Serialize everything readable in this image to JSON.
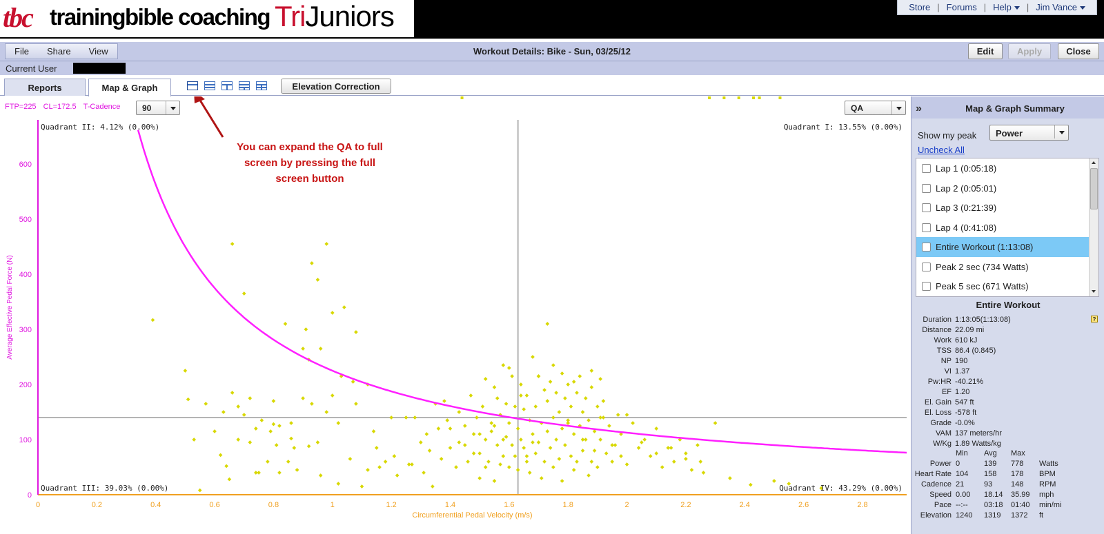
{
  "banner": {
    "logo_tbc": "tbc",
    "logo_main": "trainingbible coaching",
    "logo_tri": "Tri",
    "logo_juniors": "Juniors",
    "nav": [
      {
        "label": "Store",
        "dropdown": false
      },
      {
        "label": "Forums",
        "dropdown": false
      },
      {
        "label": "Help",
        "dropdown": true
      },
      {
        "label": "Jim Vance",
        "dropdown": true
      }
    ]
  },
  "toolbar": {
    "menu": [
      "File",
      "Share",
      "View"
    ],
    "title": "Workout Details: Bike - Sun, 03/25/12",
    "edit_label": "Edit",
    "apply_label": "Apply",
    "close_label": "Close"
  },
  "user": {
    "label": "Current User"
  },
  "tabs": {
    "reports": "Reports",
    "map_graph": "Map & Graph",
    "elevation": "Elevation Correction"
  },
  "chart_panel": {
    "ftp": "FTP=225",
    "cl": "CL=172.5",
    "tcadence": "T-Cadence",
    "cadence_value": "90",
    "mode_value": "QA",
    "annotation": [
      "You can expand the QA to full",
      "screen by pressing the full",
      "screen button"
    ]
  },
  "chart_data": {
    "type": "scatter",
    "xlabel": "Circumferential Pedal Velocity (m/s)",
    "ylabel": "Average Effective Pedal Force (N)",
    "xlim": [
      0,
      2.95
    ],
    "ylim": [
      0,
      680
    ],
    "xticks": [
      0,
      0.2,
      0.4,
      0.6,
      0.8,
      1,
      1.2,
      1.4,
      1.6,
      1.8,
      2,
      2.2,
      2.4,
      2.6,
      2.8
    ],
    "xtick_labels": [
      "0",
      "0.2",
      "0.4",
      "0.6",
      "0.8",
      "1",
      "1.2",
      "1.4",
      "1.6",
      "1.8",
      "2",
      "2.2",
      "2.4",
      "2.6",
      "2.8"
    ],
    "yticks": [
      0,
      100,
      200,
      300,
      400,
      500,
      600
    ],
    "ytick_labels": [
      "0",
      "100",
      "200",
      "300",
      "400",
      "500",
      "600"
    ],
    "quadrant_x": 1.63,
    "quadrant_y": 140,
    "quadrants": {
      "q1": "Quadrant I: 13.55% (0.00%)",
      "q2": "Quadrant II: 4.12% (0.00%)",
      "q3": "Quadrant III: 39.03% (0.00%)",
      "q4": "Quadrant IV: 43.29% (0.00%)"
    },
    "curve": {
      "ftp_watts": 225,
      "description": "force = FTP / velocity"
    },
    "colors": {
      "points": "#d8d800",
      "curve": "#ff20ff",
      "x_axis": "#f0a020",
      "y_axis": "#e018e0",
      "quadrant_lines": "#b4b4b4"
    },
    "points_x": [
      0.39,
      0.5,
      0.51,
      0.53,
      0.55,
      0.6,
      0.62,
      0.64,
      0.65,
      0.66,
      0.68,
      0.7,
      0.72,
      0.74,
      0.76,
      0.78,
      0.8,
      0.82,
      0.84,
      0.86,
      0.88,
      0.9,
      0.92,
      0.93,
      0.95,
      0.96,
      0.98,
      1.0,
      1.02,
      1.04,
      1.06,
      1.08,
      1.1,
      1.12,
      1.15,
      1.2,
      1.25,
      1.28,
      1.3,
      1.32,
      1.35,
      1.38,
      1.4,
      1.42,
      1.43,
      1.45,
      1.46,
      1.47,
      1.48,
      1.49,
      1.5,
      1.5,
      1.51,
      1.52,
      1.52,
      1.53,
      1.54,
      1.54,
      1.55,
      1.55,
      1.56,
      1.56,
      1.57,
      1.57,
      1.58,
      1.58,
      1.59,
      1.59,
      1.6,
      1.6,
      1.61,
      1.61,
      1.62,
      1.62,
      1.63,
      1.63,
      1.64,
      1.64,
      1.65,
      1.65,
      1.66,
      1.66,
      1.67,
      1.67,
      1.68,
      1.68,
      1.69,
      1.69,
      1.7,
      1.7,
      1.71,
      1.71,
      1.72,
      1.72,
      1.73,
      1.73,
      1.74,
      1.74,
      1.75,
      1.75,
      1.76,
      1.76,
      1.77,
      1.77,
      1.78,
      1.78,
      1.79,
      1.79,
      1.8,
      1.8,
      1.81,
      1.81,
      1.82,
      1.82,
      1.83,
      1.83,
      1.84,
      1.84,
      1.85,
      1.85,
      1.86,
      1.86,
      1.87,
      1.87,
      1.88,
      1.88,
      1.89,
      1.89,
      1.9,
      1.9,
      1.91,
      1.91,
      1.92,
      1.93,
      1.94,
      1.95,
      1.96,
      1.97,
      1.98,
      2.0,
      2.02,
      2.04,
      2.06,
      2.08,
      2.1,
      2.12,
      2.14,
      2.16,
      2.18,
      2.2,
      2.22,
      2.24,
      2.26,
      2.3,
      2.35,
      2.42,
      2.5,
      2.55,
      2.66,
      0.66,
      0.7,
      0.91,
      0.93,
      0.96,
      0.92,
      1.0,
      1.07,
      1.03,
      1.73,
      1.91,
      1.64,
      1.45,
      1.43,
      1.4,
      1.66,
      0.82,
      0.9,
      1.08,
      1.55,
      1.6,
      1.75,
      1.8,
      1.85,
      1.95,
      2.1,
      2.2,
      2.25,
      1.7,
      1.78,
      1.82,
      1.88,
      1.92,
      2.0,
      2.05,
      1.5,
      1.52,
      1.58,
      1.68,
      0.8,
      0.85,
      0.87,
      0.75,
      0.95,
      1.02,
      0.72,
      0.63,
      0.57,
      1.36,
      1.48,
      1.98,
      2.15,
      0.79,
      0.86,
      0.98,
      1.12,
      1.18,
      1.22,
      1.27,
      1.33,
      1.37,
      0.68,
      0.74,
      0.81,
      1.14,
      1.16,
      1.21,
      1.26,
      1.31,
      1.34,
      1.39,
      1.44,
      2.28,
      2.33,
      2.38,
      2.45,
      2.52,
      2.43
    ],
    "points_y": [
      317,
      225,
      173,
      100,
      8,
      115,
      72,
      52,
      28,
      185,
      160,
      145,
      95,
      120,
      135,
      60,
      128,
      40,
      310,
      102,
      45,
      265,
      88,
      420,
      390,
      35,
      455,
      180,
      20,
      340,
      65,
      295,
      15,
      200,
      85,
      140,
      140,
      140,
      95,
      110,
      165,
      170,
      120,
      50,
      150,
      90,
      60,
      180,
      110,
      140,
      75,
      30,
      160,
      100,
      210,
      60,
      130,
      115,
      25,
      195,
      90,
      175,
      145,
      55,
      70,
      235,
      105,
      165,
      50,
      130,
      90,
      215,
      160,
      70,
      120,
      45,
      100,
      200,
      85,
      155,
      60,
      180,
      135,
      40,
      110,
      250,
      75,
      160,
      95,
      215,
      30,
      130,
      190,
      60,
      115,
      170,
      85,
      205,
      140,
      50,
      100,
      185,
      65,
      150,
      120,
      25,
      175,
      90,
      200,
      135,
      70,
      160,
      45,
      110,
      185,
      60,
      125,
      215,
      80,
      150,
      100,
      175,
      35,
      135,
      60,
      195,
      115,
      80,
      160,
      50,
      140,
      100,
      170,
      75,
      125,
      60,
      90,
      145,
      110,
      55,
      130,
      85,
      100,
      70,
      120,
      50,
      85,
      60,
      100,
      75,
      45,
      90,
      40,
      130,
      30,
      18,
      25,
      20,
      12,
      455,
      365,
      300,
      165,
      265,
      245,
      330,
      205,
      215,
      310,
      210,
      180,
      125,
      95,
      85,
      70,
      125,
      175,
      165,
      125,
      230,
      235,
      130,
      100,
      90,
      75,
      65,
      60,
      215,
      220,
      205,
      225,
      140,
      145,
      95,
      110,
      50,
      100,
      95,
      170,
      60,
      85,
      40,
      95,
      130,
      175,
      150,
      165,
      120,
      75,
      70,
      85,
      115,
      130,
      150,
      45,
      60,
      35,
      55,
      80,
      65,
      100,
      40,
      90,
      115,
      50,
      70,
      55,
      40,
      15,
      135
    ]
  },
  "summary": {
    "title": "Map & Graph Summary",
    "peak_label": "Show my peak",
    "peak_value": "Power",
    "uncheck_all": "Uncheck All",
    "laps": [
      {
        "label": "Lap 1 (0:05:18)",
        "selected": false
      },
      {
        "label": "Lap 2 (0:05:01)",
        "selected": false
      },
      {
        "label": "Lap 3 (0:21:39)",
        "selected": false
      },
      {
        "label": "Lap 4 (0:41:08)",
        "selected": false
      },
      {
        "label": "Entire Workout (1:13:08)",
        "selected": true
      },
      {
        "label": "Peak  2 sec (734 Watts)",
        "selected": false
      },
      {
        "label": "Peak  5 sec (671 Watts)",
        "selected": false
      }
    ],
    "details_title": "Entire Workout",
    "help_label": "?",
    "stats": [
      {
        "k": "Duration",
        "v": "1:13:05(1:13:08)"
      },
      {
        "k": "Distance",
        "v": "22.09 mi"
      },
      {
        "k": "Work",
        "v": "610 kJ"
      },
      {
        "k": "TSS",
        "v": "86.4 (0.845)"
      },
      {
        "k": "NP",
        "v": "190"
      },
      {
        "k": "VI",
        "v": "1.37"
      },
      {
        "k": "Pw:HR",
        "v": "-40.21%"
      },
      {
        "k": "EF",
        "v": "1.20"
      },
      {
        "k": "El. Gain",
        "v": "547 ft"
      },
      {
        "k": "El. Loss",
        "v": "-578 ft"
      },
      {
        "k": "Grade",
        "v": "-0.0%"
      },
      {
        "k": "VAM",
        "v": "137 meters/hr"
      },
      {
        "k": "W/Kg",
        "v": "1.89 Watts/kg"
      }
    ],
    "minmax_headers": [
      "Min",
      "Avg",
      "Max"
    ],
    "minmax": [
      {
        "k": "Power",
        "min": "0",
        "avg": "139",
        "max": "778",
        "unit": "Watts"
      },
      {
        "k": "Heart Rate",
        "min": "104",
        "avg": "158",
        "max": "178",
        "unit": "BPM"
      },
      {
        "k": "Cadence",
        "min": "21",
        "avg": "93",
        "max": "148",
        "unit": "RPM"
      },
      {
        "k": "Speed",
        "min": "0.00",
        "avg": "18.14",
        "max": "35.99",
        "unit": "mph"
      },
      {
        "k": "Pace",
        "min": "--:--",
        "avg": "03:18",
        "max": "01:40",
        "unit": "min/mi"
      },
      {
        "k": "Elevation",
        "min": "1240",
        "avg": "1319",
        "max": "1372",
        "unit": "ft"
      }
    ]
  }
}
